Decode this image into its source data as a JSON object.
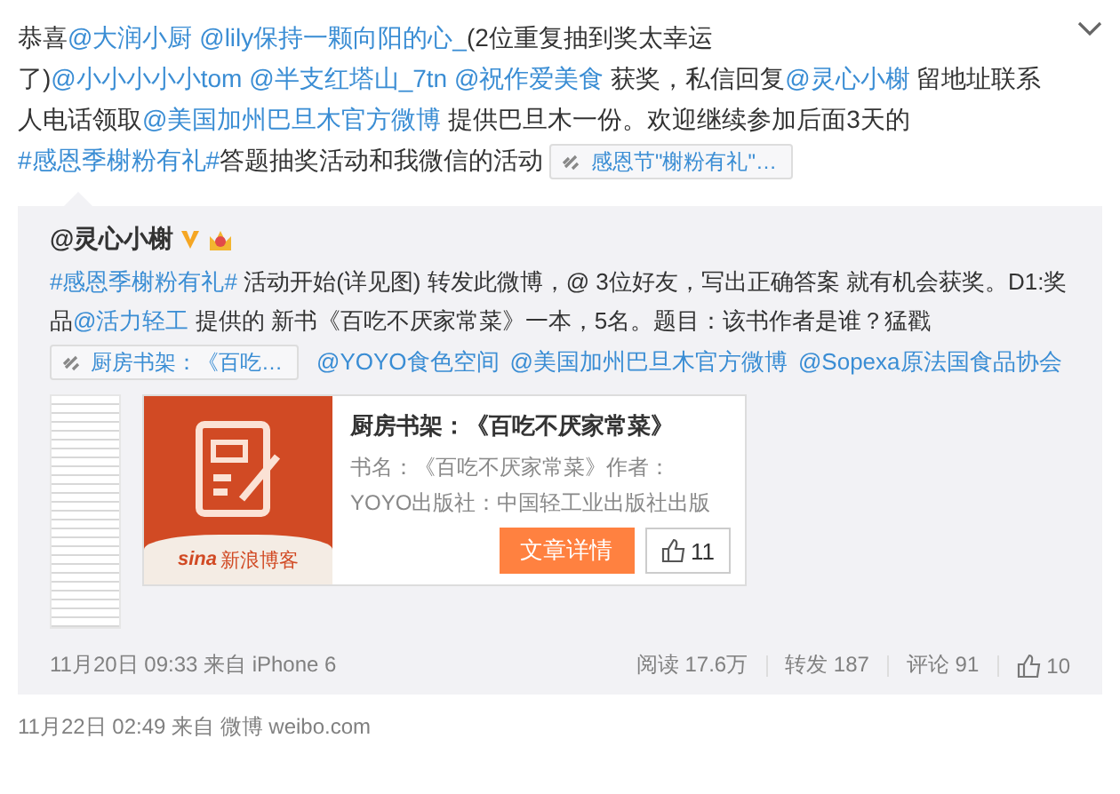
{
  "post": {
    "segments": [
      {
        "kind": "text",
        "text": "恭喜"
      },
      {
        "kind": "mention",
        "text": "@大润小厨 "
      },
      {
        "kind": "mention",
        "text": "@lily保持一颗向阳的心_"
      },
      {
        "kind": "text",
        "text": "(2位重复抽到奖太幸运了)"
      },
      {
        "kind": "mention",
        "text": "@小小小小小tom "
      },
      {
        "kind": "mention",
        "text": "@半支红塔山_7tn "
      },
      {
        "kind": "mention",
        "text": "@祝作爱美食"
      },
      {
        "kind": "text",
        "text": " 获奖，私信回复"
      },
      {
        "kind": "mention",
        "text": "@灵心小榭"
      },
      {
        "kind": "text",
        "text": " 留地址联系人电话领取"
      },
      {
        "kind": "mention",
        "text": "@美国加州巴旦木官方微博"
      },
      {
        "kind": "text",
        "text": " 提供巴旦木一份。欢迎继续参加后面3天的"
      },
      {
        "kind": "hashtag",
        "text": "#感恩季榭粉有礼#"
      },
      {
        "kind": "text",
        "text": "答题抽奖活动和我微信的活动 "
      }
    ],
    "link_chip": "感恩节\"榭粉有礼\"…"
  },
  "repost": {
    "author": "@灵心小榭",
    "segments": [
      {
        "kind": "hashtag",
        "text": "#感恩季榭粉有礼#"
      },
      {
        "kind": "text",
        "text": " 活动开始(详见图) 转发此微博，@ 3位好友，写出正确答案 就有机会获奖。D1:奖品"
      },
      {
        "kind": "mention",
        "text": "@活力轻工"
      },
      {
        "kind": "text",
        "text": " 提供的 新书《百吃不厌家常菜》一本，5名。题目：该书作者是谁？猛戳"
      }
    ],
    "link_chip": "厨房书架：《百吃…",
    "mentions": [
      "@YOYO食色空间",
      "@美国加州巴旦木官方微博",
      "@Sopexa原法国食品协会"
    ],
    "card": {
      "logo_mark": "sina",
      "logo": "新浪博客",
      "title": "厨房书架：《百吃不厌家常菜》",
      "description": "书名：《百吃不厌家常菜》作者：YOYO出版社：中国轻工业出版社出版",
      "button": "文章详情",
      "likes": "11"
    },
    "time": "11月20日 09:33 来自 iPhone 6",
    "stats": [
      "阅读 17.6万",
      "转发 187",
      "评论 91"
    ],
    "likes": "10"
  },
  "time": "11月22日 02:49 来自 微博 weibo.com"
}
